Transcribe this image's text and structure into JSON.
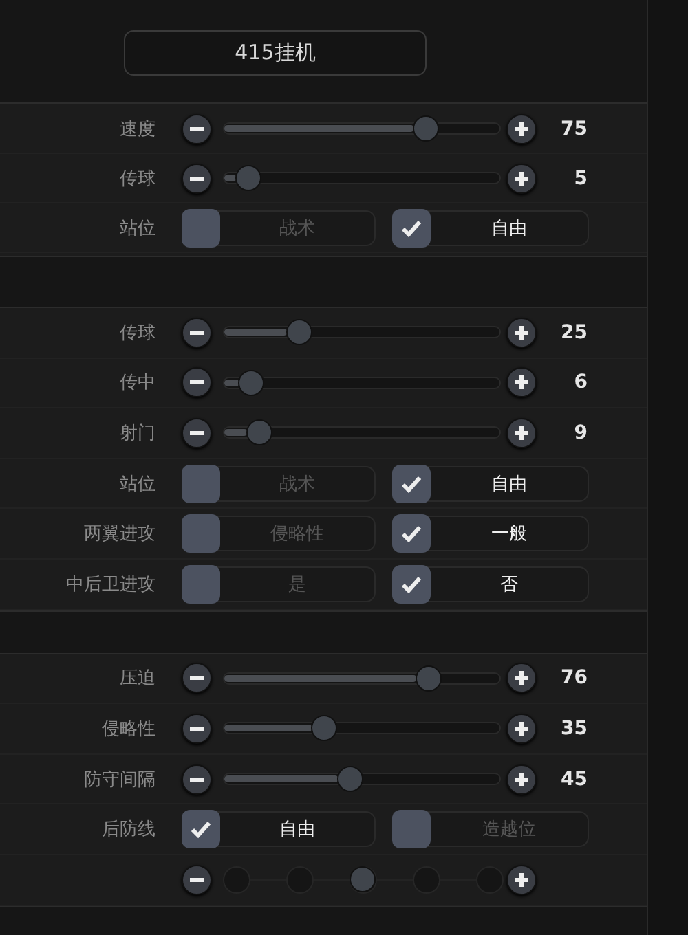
{
  "title": "415挂机",
  "sections": [
    {
      "rows": [
        {
          "kind": "slider",
          "label": "速度",
          "level": 0.75,
          "reading": "75"
        },
        {
          "kind": "slider",
          "label": "传球",
          "level": 0.05,
          "reading": "5"
        },
        {
          "kind": "choice",
          "label": "站位",
          "options": [
            {
              "label": "战术",
              "checked": false
            },
            {
              "label": "自由",
              "checked": true
            }
          ]
        }
      ]
    },
    {
      "rows": [
        {
          "kind": "slider",
          "label": "传球",
          "level": 0.25,
          "reading": "25"
        },
        {
          "kind": "slider",
          "label": "传中",
          "level": 0.06,
          "reading": "6"
        },
        {
          "kind": "slider",
          "label": "射门",
          "level": 0.09,
          "reading": "9"
        },
        {
          "kind": "choice",
          "label": "站位",
          "options": [
            {
              "label": "战术",
              "checked": false
            },
            {
              "label": "自由",
              "checked": true
            }
          ]
        },
        {
          "kind": "choice",
          "label": "两翼进攻",
          "options": [
            {
              "label": "侵略性",
              "checked": false
            },
            {
              "label": "一般",
              "checked": true
            }
          ]
        },
        {
          "kind": "choice",
          "label": "中后卫进攻",
          "options": [
            {
              "label": "是",
              "checked": false
            },
            {
              "label": "否",
              "checked": true
            }
          ]
        }
      ]
    },
    {
      "rows": [
        {
          "kind": "slider",
          "label": "压迫",
          "level": 0.76,
          "reading": "76"
        },
        {
          "kind": "slider",
          "label": "侵略性",
          "level": 0.35,
          "reading": "35"
        },
        {
          "kind": "slider",
          "label": "防守间隔",
          "level": 0.45,
          "reading": "45"
        },
        {
          "kind": "choice",
          "label": "后防线",
          "options": [
            {
              "label": "自由",
              "checked": true
            },
            {
              "label": "造越位",
              "checked": false
            }
          ]
        },
        {
          "kind": "steps",
          "level": 0.5
        }
      ]
    }
  ]
}
